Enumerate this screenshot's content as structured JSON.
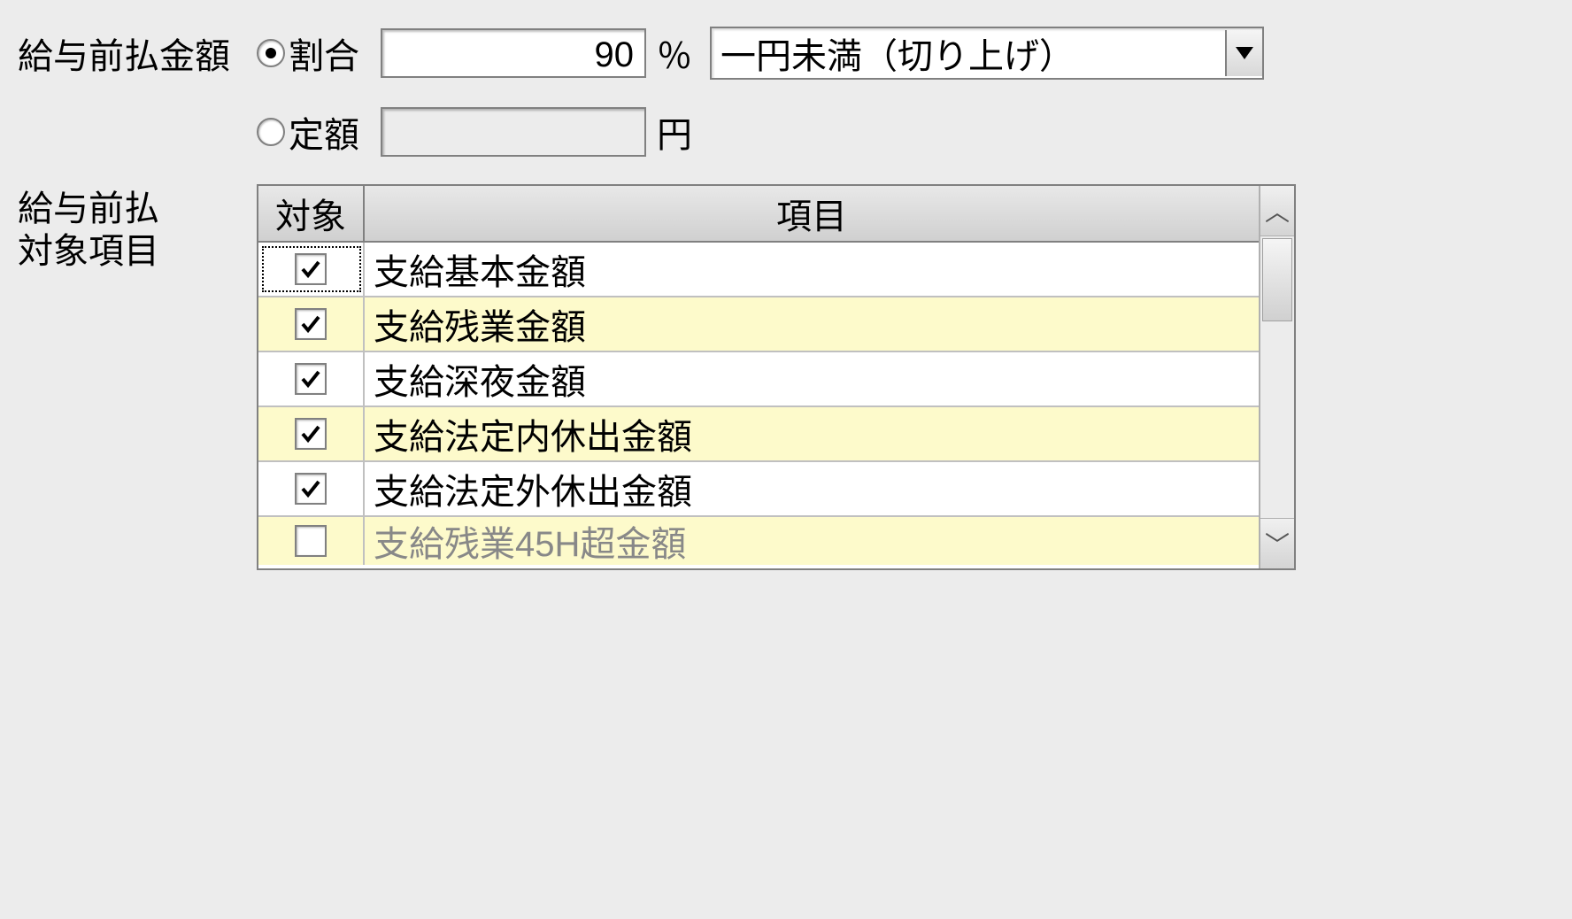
{
  "main_label": "給与前払金額",
  "radio_percent_label": "割合",
  "radio_fixed_label": "定額",
  "percent_value": "90",
  "percent_unit": "％",
  "fixed_value": "",
  "fixed_unit": "円",
  "rounding_selected": "一円未満（切り上げ）",
  "table_side_label_line1": "給与前払",
  "table_side_label_line2": "対象項目",
  "header_target": "対象",
  "header_item": "項目",
  "rows": [
    {
      "checked": true,
      "label": "支給基本金額"
    },
    {
      "checked": true,
      "label": "支給残業金額"
    },
    {
      "checked": true,
      "label": "支給深夜金額"
    },
    {
      "checked": true,
      "label": "支給法定内休出金額"
    },
    {
      "checked": true,
      "label": "支給法定外休出金額"
    },
    {
      "checked": false,
      "label": "支給残業45H超金額"
    }
  ],
  "scroll_up_glyph": "︿",
  "scroll_down_glyph": "﹀"
}
